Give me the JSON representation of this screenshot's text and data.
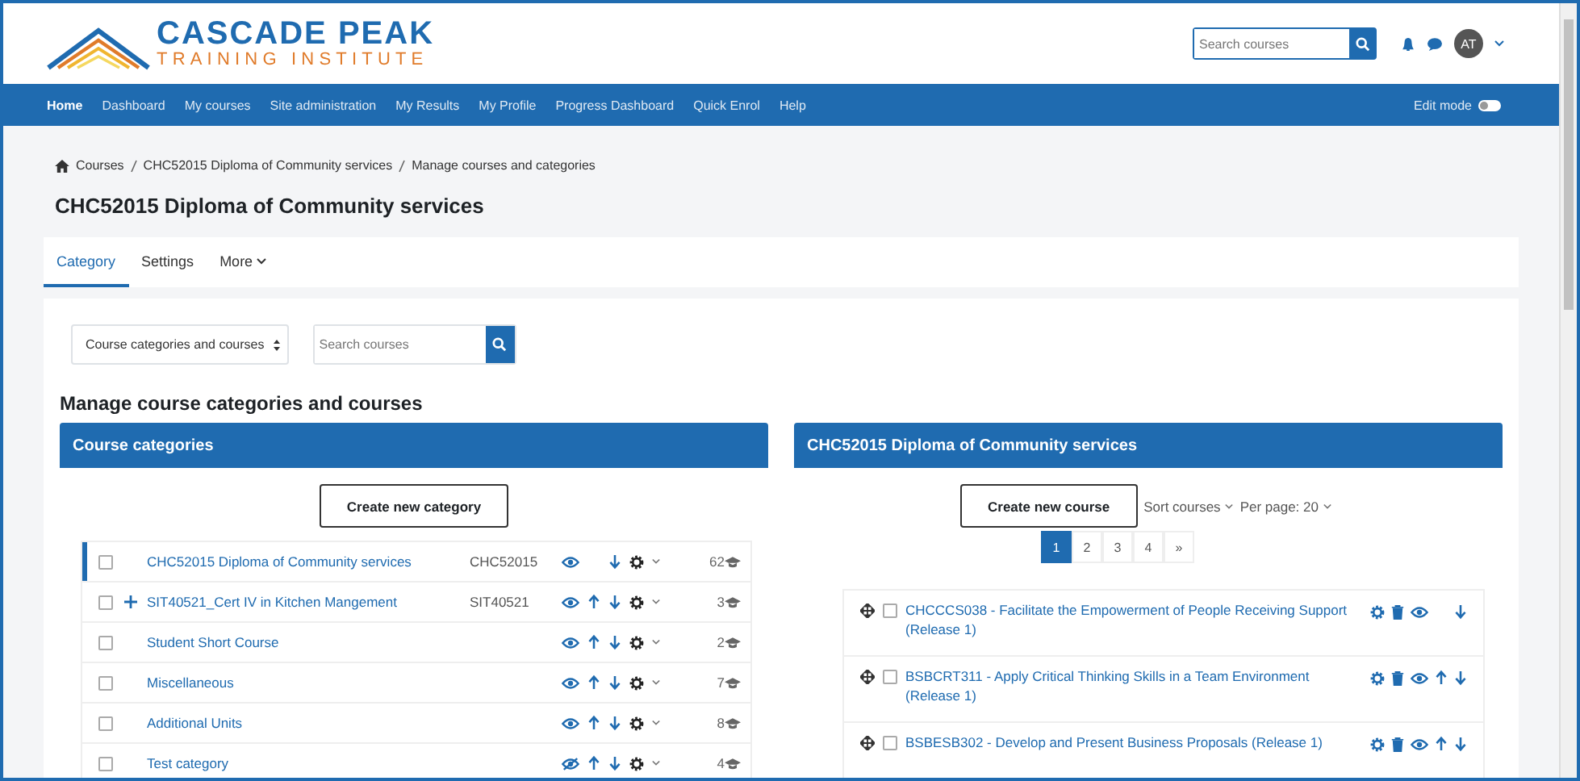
{
  "logo": {
    "name": "CASCADE PEAK",
    "tagline": "TRAINING INSTITUTE"
  },
  "header": {
    "search_placeholder": "Search courses",
    "avatar": "AT"
  },
  "nav": {
    "items": [
      {
        "label": "Home",
        "selected": true
      },
      {
        "label": "Dashboard",
        "selected": false
      },
      {
        "label": "My courses",
        "selected": false
      },
      {
        "label": "Site administration",
        "selected": false
      },
      {
        "label": "My Results",
        "selected": false
      },
      {
        "label": "My Profile",
        "selected": false
      },
      {
        "label": "Progress Dashboard",
        "selected": false
      },
      {
        "label": "Quick Enrol",
        "selected": false
      },
      {
        "label": "Help",
        "selected": false
      }
    ],
    "edit_mode": {
      "label": "Edit mode",
      "on": false
    }
  },
  "breadcrumb": [
    "Courses",
    "CHC52015 Diploma of Community services",
    "Manage courses and categories"
  ],
  "page_title": "CHC52015 Diploma of Community services",
  "tabs": [
    {
      "label": "Category",
      "selected": true,
      "dropdown": false
    },
    {
      "label": "Settings",
      "selected": false,
      "dropdown": false
    },
    {
      "label": "More",
      "selected": false,
      "dropdown": true
    }
  ],
  "view_select": "Course categories and courses",
  "search_placeholder": "Search courses",
  "heading": "Manage course categories and courses",
  "categories": {
    "title": "Course categories",
    "create_button": "Create new category",
    "items": [
      {
        "name": "CHC52015 Diploma of Community services",
        "idnumber": "CHC52015",
        "count": "62",
        "selected": true,
        "checked": false,
        "has_children": false,
        "visible": true,
        "move_up": false
      },
      {
        "name": "SIT40521_Cert IV in Kitchen Mangement",
        "idnumber": "SIT40521",
        "count": "3",
        "selected": false,
        "checked": false,
        "has_children": true,
        "visible": true,
        "move_up": true
      },
      {
        "name": "Student Short Course",
        "count": "2",
        "selected": false,
        "checked": false,
        "has_children": false,
        "visible": true,
        "move_up": true
      },
      {
        "name": "Miscellaneous",
        "count": "7",
        "selected": false,
        "checked": false,
        "has_children": false,
        "visible": true,
        "move_up": true
      },
      {
        "name": "Additional Units",
        "count": "8",
        "selected": false,
        "checked": false,
        "has_children": false,
        "visible": true,
        "move_up": true
      },
      {
        "name": "Test category",
        "count": "4",
        "selected": false,
        "checked": false,
        "has_children": false,
        "visible": false,
        "move_up": true
      }
    ]
  },
  "courses": {
    "title": "CHC52015 Diploma of Community services",
    "create_button": "Create new course",
    "sort": "Sort courses",
    "per_page": "Per page: 20",
    "pages": [
      {
        "label": "1",
        "selected": true
      },
      {
        "label": "2",
        "selected": false
      },
      {
        "label": "3",
        "selected": false
      },
      {
        "label": "4",
        "selected": false
      },
      {
        "label": "»",
        "selected": false
      }
    ],
    "items": [
      {
        "name": "CHCCCS038 - Facilitate the Empowerment of People Receiving Support (Release 1)",
        "checked": false,
        "move_up": false
      },
      {
        "name": "BSBCRT311 - Apply Critical Thinking Skills in a Team Environment (Release 1)",
        "checked": false,
        "move_up": true
      },
      {
        "name": "BSBESB302 - Develop and Present Business Proposals (Release 1)",
        "checked": false,
        "move_up": true
      }
    ]
  }
}
